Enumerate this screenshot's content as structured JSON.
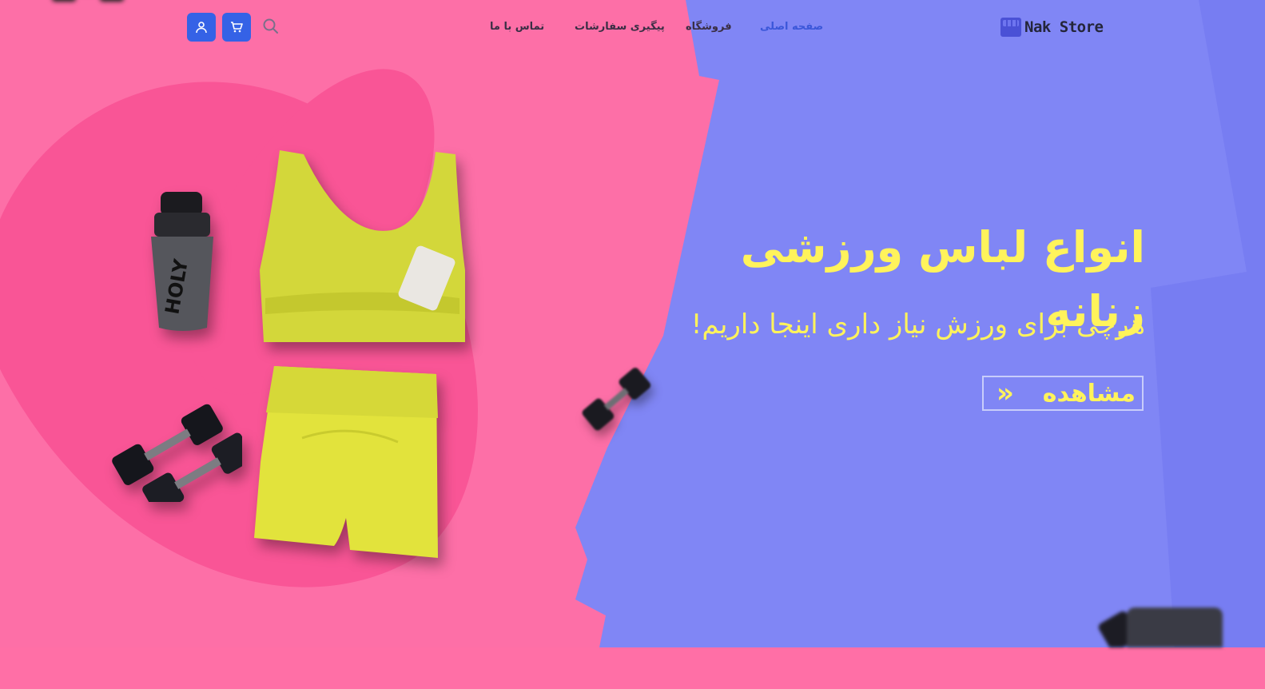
{
  "header": {
    "brand": "Nak Store",
    "nav": [
      {
        "label": "صفحه اصلی",
        "active": true
      },
      {
        "label": "فروشگاه",
        "active": false
      },
      {
        "label": "پیگیری سفارشات",
        "active": false
      },
      {
        "label": "تماس با ما",
        "active": false
      }
    ],
    "icons": [
      "search-icon",
      "cart-icon",
      "user-icon"
    ]
  },
  "hero": {
    "title": "انواع لباس ورزشی زنانه",
    "subtitle": "هرچی برای ورزش نیاز داری اینجا داریم!",
    "cta_label": "مشاهده",
    "cta_arrow": "»"
  },
  "colors": {
    "pink": "#fd6fa7",
    "purple": "#8086f5",
    "accent": "#3562e6",
    "yellow": "#fff35b"
  }
}
